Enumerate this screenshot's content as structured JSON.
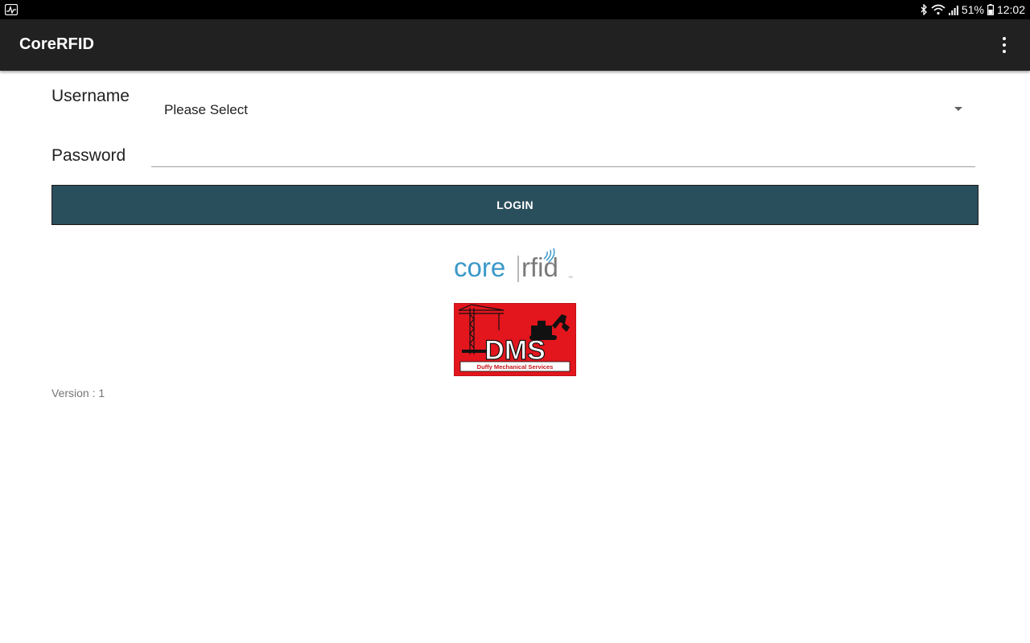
{
  "status_bar": {
    "battery": "51%",
    "time": "12:02",
    "icons": [
      "activity-icon",
      "bluetooth-icon",
      "wifi-icon",
      "signal-icon",
      "battery-icon"
    ]
  },
  "app_bar": {
    "title": "CoreRFID",
    "background": "#212121",
    "overflow_icon": "more-vert-icon"
  },
  "form": {
    "username_label": "Username",
    "username_value": "Please Select",
    "password_label": "Password",
    "password_value": "",
    "login_label": "LOGIN",
    "login_color": "#2a4f5c"
  },
  "logos": {
    "corerfid": {
      "core_text": "core",
      "rfid_text": "rfid",
      "tm": "TM"
    },
    "dms": {
      "acronym": "DMS",
      "company": "Duffy Mechanical Services",
      "background": "#e3161d"
    }
  },
  "footer": {
    "version": "Version : 1"
  }
}
